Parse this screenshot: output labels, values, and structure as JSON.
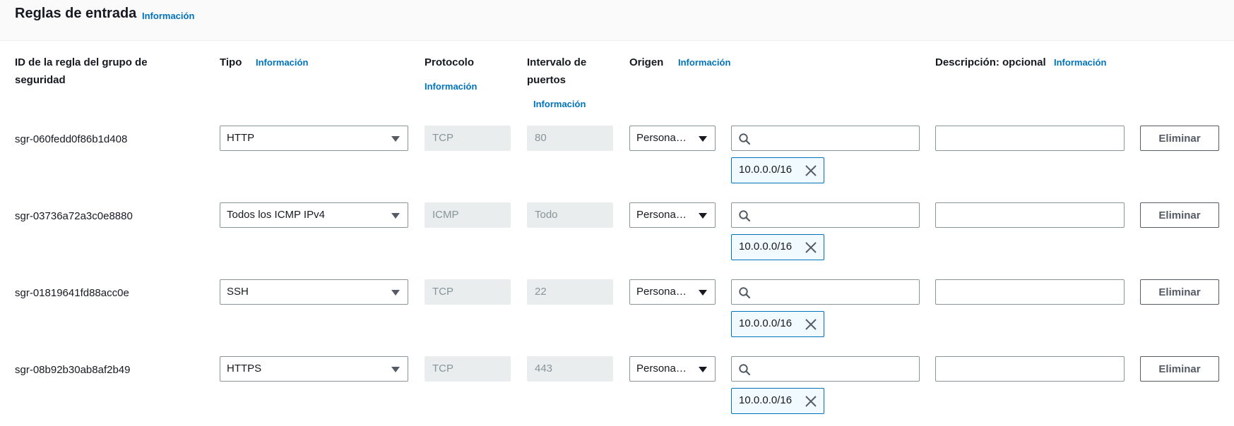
{
  "section": {
    "title": "Reglas de entrada",
    "info": "Información"
  },
  "columns": {
    "rule_id": [
      "ID de la regla del grupo de",
      "seguridad"
    ],
    "type": "Tipo",
    "type_info": "Información",
    "protocol": "Protocolo",
    "protocol_info": "Información",
    "port_range": [
      "Intervalo de",
      "puertos"
    ],
    "port_range_info": "Información",
    "source": "Origen",
    "source_info": "Información",
    "description": "Descripción: opcional",
    "description_info": "Información"
  },
  "rules": [
    {
      "id": "sgr-060fedd0f86b1d408",
      "type": "HTTP",
      "protocol": "TCP",
      "port_range": "80",
      "source_type": "Persona…",
      "search_value": "",
      "cidr": "10.0.0.0/16",
      "description": "",
      "delete_label": "Eliminar"
    },
    {
      "id": "sgr-03736a72a3c0e8880",
      "type": "Todos los ICMP IPv4",
      "protocol": "ICMP",
      "port_range": "Todo",
      "source_type": "Persona…",
      "search_value": "",
      "cidr": "10.0.0.0/16",
      "description": "",
      "delete_label": "Eliminar"
    },
    {
      "id": "sgr-01819641fd88acc0e",
      "type": "SSH",
      "protocol": "TCP",
      "port_range": "22",
      "source_type": "Persona…",
      "search_value": "",
      "cidr": "10.0.0.0/16",
      "description": "",
      "delete_label": "Eliminar"
    },
    {
      "id": "sgr-08b92b30ab8af2b49",
      "type": "HTTPS",
      "protocol": "TCP",
      "port_range": "443",
      "source_type": "Persona…",
      "search_value": "",
      "cidr": "10.0.0.0/16",
      "description": "",
      "delete_label": "Eliminar"
    }
  ],
  "icons": {
    "search": "search-icon",
    "remove": "close-icon",
    "dropdown": "caret-down-icon"
  },
  "colors": {
    "link": "#0073bb",
    "token_border": "#0073bb",
    "token_bg": "#f1faff",
    "readonly_bg": "#eaeded",
    "header_bg": "#fafafa"
  }
}
